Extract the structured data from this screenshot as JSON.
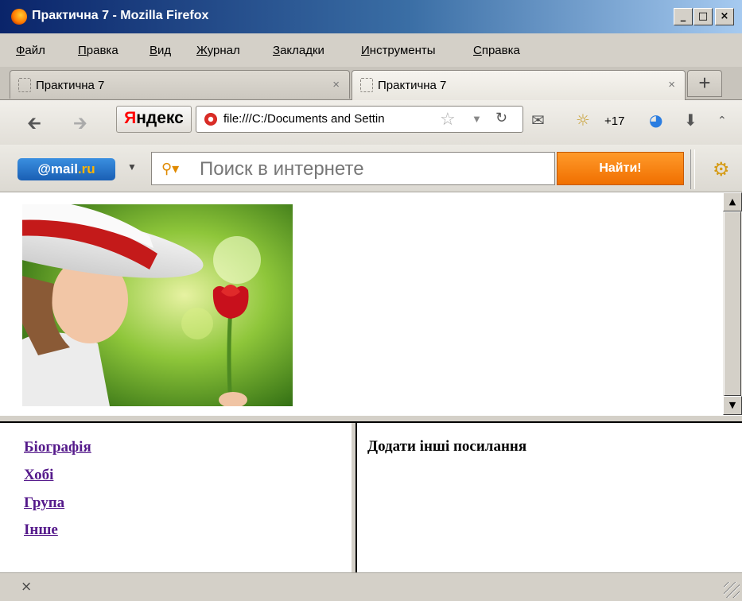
{
  "window": {
    "title": "Практична 7 - Mozilla Firefox",
    "controls": {
      "minimize": "_",
      "maximize": "□",
      "close": "×"
    }
  },
  "menu": {
    "items": [
      {
        "first": "Ф",
        "rest": "айл"
      },
      {
        "first": "П",
        "rest": "равка"
      },
      {
        "first": "В",
        "rest": "ид"
      },
      {
        "first": "Ж",
        "rest": "урнал"
      },
      {
        "first": "З",
        "rest": "акладки"
      },
      {
        "first": "И",
        "rest": "нструменты"
      },
      {
        "first": "С",
        "rest": "правка"
      }
    ]
  },
  "tabs": [
    {
      "label": "Практична 7",
      "close": "×",
      "active": false
    },
    {
      "label": "Практична 7",
      "close": "×",
      "active": true
    }
  ],
  "new_tab_label": "+",
  "nav": {
    "back_icon": "back-arrow-icon",
    "forward_icon": "forward-arrow-icon",
    "yandex_first": "Я",
    "yandex_rest": "ндекс",
    "url": "file:///C:/Documents and Settin",
    "weather": "+17"
  },
  "search": {
    "mailru_prefix": "@mail",
    "mailru_suffix": ".ru",
    "placeholder": "Поиск в интернете",
    "button_label": "Найти!"
  },
  "left_frame": {
    "links": [
      "Біографія",
      "Хобі",
      "Група",
      "Інше"
    ]
  },
  "right_frame": {
    "text": "Додати інші посилання"
  },
  "status": {
    "close": "×"
  },
  "colors": {
    "link_visited": "#551a8b",
    "search_button": "#f07a00",
    "titlebar_start": "#0a246a",
    "titlebar_end": "#a6caf0"
  }
}
